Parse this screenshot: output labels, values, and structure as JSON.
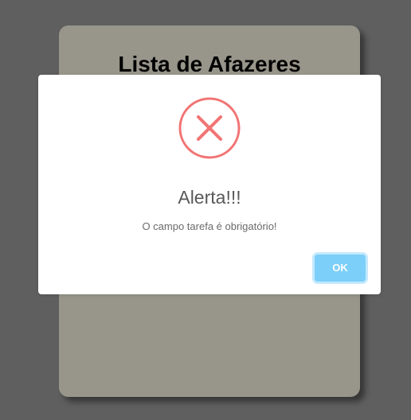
{
  "background_card": {
    "title": "Lista de Afazeres"
  },
  "alert": {
    "icon": "error-x-icon",
    "title": "Alerta!!!",
    "message": "O campo tarefa é obrigatório!",
    "confirm_label": "OK"
  },
  "colors": {
    "overlay": "#5f5f5f",
    "card": "#98968b",
    "error_icon": "#f27474",
    "confirm_button": "#7ccff8"
  }
}
